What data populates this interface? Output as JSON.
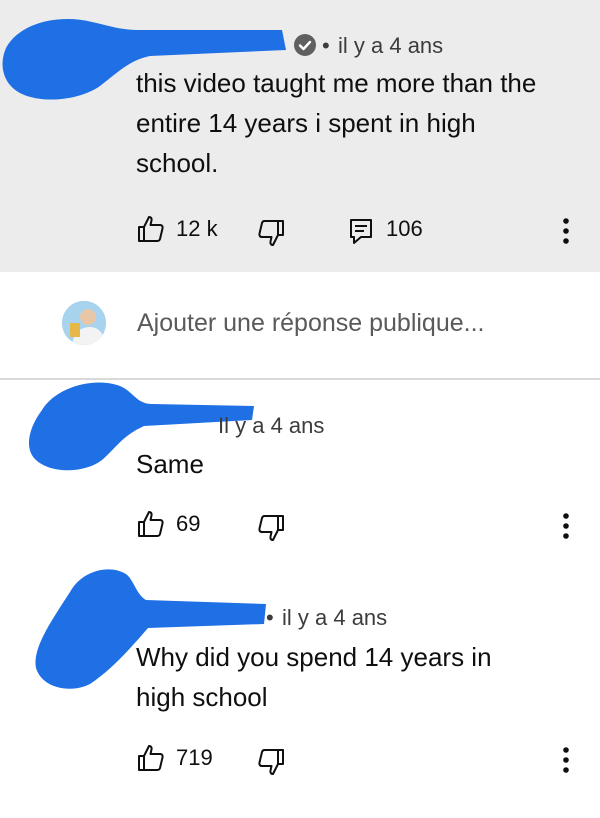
{
  "comments": [
    {
      "time": "il y a 4 ans",
      "separator": "•",
      "text_lines": [
        "this video taught me more than the",
        "entire 14 years i spent in high",
        "school."
      ],
      "likes": "12 k",
      "replies": "106"
    },
    {
      "time": "Il y a 4 ans",
      "text_lines": [
        "Same"
      ],
      "likes": "69"
    },
    {
      "time": "il y a 4 ans",
      "separator": "•",
      "text_lines": [
        "Why did you spend 14 years in",
        "high school"
      ],
      "likes": "719"
    }
  ],
  "reply_box": {
    "placeholder": "Ajouter une réponse publique..."
  },
  "icons": {
    "like": "thumbs-up-icon",
    "dislike": "thumbs-down-icon",
    "reply": "reply-comment-icon",
    "menu": "more-vertical-icon",
    "verified": "verified-check-icon"
  },
  "colors": {
    "highlight_bg": "#ececec",
    "redaction": "#1f6fe5"
  }
}
